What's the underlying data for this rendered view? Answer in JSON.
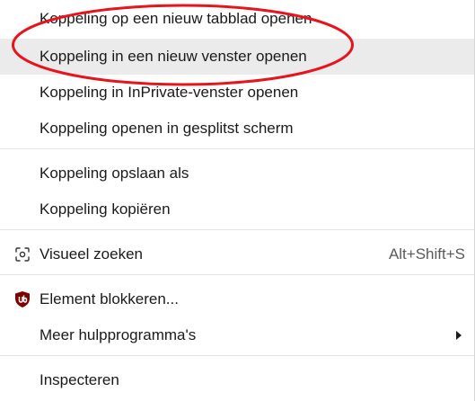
{
  "menu": {
    "items": [
      {
        "label": "Koppeling op een nieuw tabblad openen"
      },
      {
        "label": "Koppeling in een nieuw venster openen"
      },
      {
        "label": "Koppeling in InPrivate-venster openen"
      },
      {
        "label": "Koppeling openen in gesplitst scherm"
      },
      {
        "label": "Koppeling opslaan als"
      },
      {
        "label": "Koppeling kopiëren"
      },
      {
        "label": "Visueel zoeken",
        "shortcut": "Alt+Shift+S",
        "icon": "visual-search-icon"
      },
      {
        "label": "Element blokkeren...",
        "icon": "ublock-origin-icon"
      },
      {
        "label": "Meer hulpprogramma's",
        "icon": "submenu-arrow-icon"
      },
      {
        "label": "Inspecteren"
      }
    ]
  },
  "colors": {
    "hover_background": "#ebebeb",
    "annotation_red": "#e8141c",
    "ublock_red": "#800000"
  }
}
